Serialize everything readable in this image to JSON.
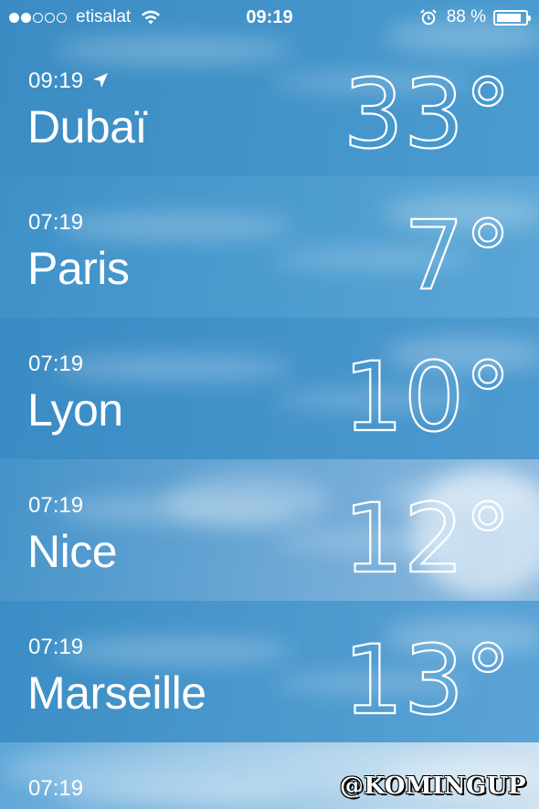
{
  "status_bar": {
    "carrier": "etisalat",
    "signal_bars_filled": 2,
    "signal_bars_total": 5,
    "time": "09:19",
    "battery_percent_label": "88 %",
    "battery_level": 0.88
  },
  "cities": [
    {
      "time": "09:19",
      "name": "Dubaï",
      "temp": "33°",
      "is_current_location": true,
      "colors": [
        "#3b8cc3",
        "#4a9bd0"
      ]
    },
    {
      "time": "07:19",
      "name": "Paris",
      "temp": "7°",
      "is_current_location": false,
      "colors": [
        "#3e91c8",
        "#5aa6d6"
      ]
    },
    {
      "time": "07:19",
      "name": "Lyon",
      "temp": "10°",
      "is_current_location": false,
      "colors": [
        "#3a8bc4",
        "#4c9ad0"
      ]
    },
    {
      "time": "07:19",
      "name": "Nice",
      "temp": "12°",
      "is_current_location": false,
      "colors": [
        "#4593c9",
        "#8fbbe0"
      ]
    },
    {
      "time": "07:19",
      "name": "Marseille",
      "temp": "13°",
      "is_current_location": false,
      "colors": [
        "#3b8dc5",
        "#5aa3d6"
      ]
    },
    {
      "time": "07:19",
      "name": "",
      "temp": "",
      "is_current_location": false,
      "colors": [
        "#5da6d8",
        "#cfe3f1"
      ]
    }
  ],
  "watermark": "@KOMINGUP",
  "icons": {
    "wifi": "wifi-icon",
    "alarm": "alarm-clock-icon",
    "battery": "battery-icon",
    "location": "location-arrow-icon"
  }
}
